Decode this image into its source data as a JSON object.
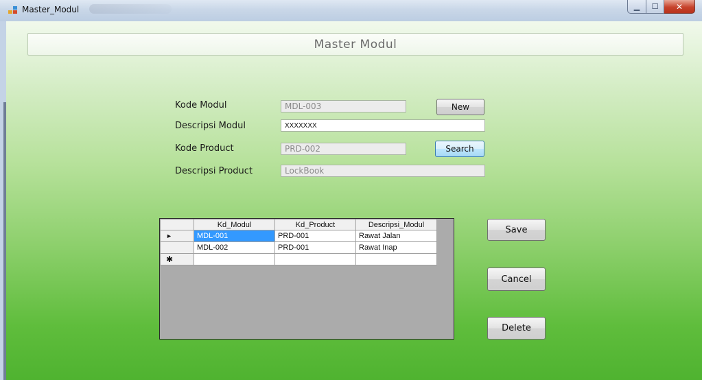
{
  "window": {
    "title": "Master_Modul",
    "minimize_icon": "minimize-icon",
    "maximize_icon": "maximize-icon",
    "close_icon": "close-icon"
  },
  "header": {
    "title": "Master Modul"
  },
  "form": {
    "kode_modul_label": "Kode Modul",
    "kode_modul_value": "MDL-003",
    "descripsi_modul_label": "Descripsi Modul",
    "descripsi_modul_value": "XXXXXXX",
    "kode_product_label": "Kode Product",
    "kode_product_value": "PRD-002",
    "descripsi_product_label": "Descripsi Product",
    "descripsi_product_value": "LockBook",
    "new_label": "New",
    "search_label": "Search"
  },
  "grid": {
    "columns": [
      "Kd_Modul",
      "Kd_Product",
      "Descripsi_Modul"
    ],
    "rows": [
      [
        "MDL-001",
        "PRD-001",
        "Rawat Jalan"
      ],
      [
        "MDL-002",
        "PRD-001",
        "Rawat Inap"
      ]
    ],
    "current_row_marker": "►",
    "new_row_marker": "✱"
  },
  "actions": {
    "save_label": "Save",
    "cancel_label": "Cancel",
    "delete_label": "Delete"
  },
  "colors": {
    "accent": "#3399ff",
    "close": "#c7432c",
    "bg_bottom": "#4fb330"
  }
}
